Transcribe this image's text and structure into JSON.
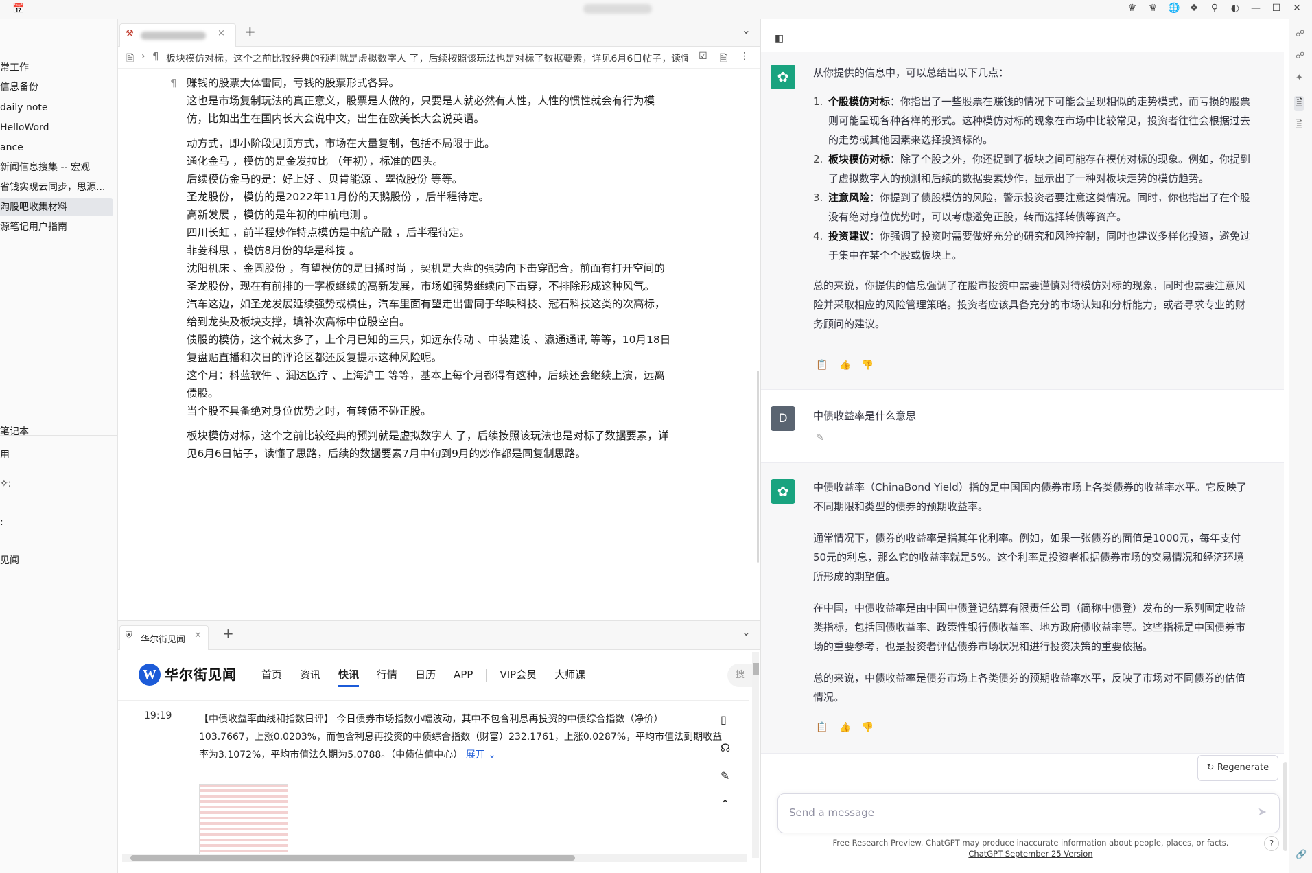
{
  "titlebar": {
    "icons": [
      "crown-icon",
      "crown-icon",
      "globe-icon",
      "puzzle-icon",
      "search-icon",
      "contrast-icon",
      "minimize-icon",
      "maximize-icon",
      "close-icon"
    ]
  },
  "sidebar": {
    "items": [
      {
        "label": "常工作"
      },
      {
        "label": "信息备份"
      },
      {
        "label": "daily note"
      },
      {
        "label": "HelloWord"
      },
      {
        "label": "ance"
      },
      {
        "label": "新闻信息搜集 -- 宏观"
      },
      {
        "label": "省钱实现云同步，思源..."
      },
      {
        "label": "淘股吧收集材料"
      },
      {
        "label": "源笔记用户指南"
      }
    ],
    "lower_items": [
      {
        "label": "笔记本"
      },
      {
        "label": "用"
      },
      {
        "label": "✧:"
      },
      {
        "label": ":"
      },
      {
        "label": "见闻"
      }
    ]
  },
  "editor": {
    "breadcrumb": "板块模仿对标，这个之前比较经典的预判就是虚拟数字人 了，后续按照该玩法也是对标了数据要素，详见6月6日帖子，读懂",
    "lines_1": [
      "赚钱的股票大体雷同，亏钱的股票形式各异。",
      "这也是市场复制玩法的真正意义，股票是人做的，只要是人就必然有人性，人性的惯性就会有行为模",
      "仿，比如出生在国内长大会说中文，出生在欧美长大会说英语。"
    ],
    "lines_2": [
      "动方式，即小阶段见顶方式，市场在大量复制，包括不局限于此。",
      "通化金马 ，模仿的是金发拉比 （年初），标准的四头。",
      "后续模仿金马的是：好上好 、贝肯能源 、翠微股份 等等。",
      "圣龙股份， 模仿的是2022年11月份的天鹅股份 ，后半程待定。",
      "高新发展 ，模仿的是年初的中航电测 。",
      "四川长虹 ，前半程炒作特点模仿是中航产融 ，后半程待定。",
      "菲菱科思 ，模仿8月份的华是科技 。",
      "沈阳机床 、金圆股份 ，有望模仿的是日播时尚 ，契机是大盘的强势向下击穿配合，前面有打开空间的",
      "圣龙股份，现在有前排的一字板继续的高新发展，市场如强势继续向下击穿，不排除形成这种风气。",
      "汽车这边，如圣龙发展延续强势或横住，汽车里面有望走出雷同于华映科技、冠石科技这类的次高标，",
      "给到龙头及板块支撑，填补次高标中位股空白。",
      "债股的模仿，这个就太多了，上个月已知的三只，如远东传动 、中装建设 、瀛通通讯 等等，10月18日",
      "复盘贴直播和次日的评论区都还反复提示这种风险呢。",
      "这个月：科蓝软件 、润达医疗 、上海沪工 等等，基本上每个月都得有这种，后续还会继续上演，远离",
      "债股。",
      "当个股不具备绝对身位优势之时，有转债不碰正股。"
    ],
    "lines_3": [
      "板块模仿对标，这个之前比较经典的预判就是虚拟数字人 了，后续按照该玩法也是对标了数据要素，详",
      "见6月6日帖子，读懂了思路，后续的数据要素7月中旬到9月的炒作都是同复制思路。"
    ]
  },
  "web": {
    "tab_label": "华尔街见闻",
    "logo_letter": "W",
    "site_name": "华尔街见闻",
    "nav": [
      "首页",
      "资讯",
      "快讯",
      "行情",
      "日历",
      "APP",
      "VIP会员",
      "大师课"
    ],
    "nav_active": "快讯",
    "search_placeholder": "搜",
    "news_time": "19:19",
    "news_lines": [
      "【中债收益率曲线和指数日评】 今日债券市场指数小幅波动，其中不包含利息再投资的中债综合指数（净价）",
      "103.7667，上涨0.0203%，而包含利息再投资的中债综合指数（财富）232.1761，上涨0.0287%，平均市值法到期收益",
      "率为3.1072%，平均市值法久期为5.0788。（中债估值中心）"
    ],
    "expand": "展开"
  },
  "chat": {
    "msg1_intro": "从你提供的信息中，可以总结出以下几点：",
    "msg1_items": [
      {
        "num": "1.",
        "title": "个股模仿对标",
        "lines": [
          "：你指出了一些股票在赚钱的情况下可能会呈现相似的走势模式，而亏损的股票",
          "则可能呈现各种各样的形式。这种模仿对标的现象在市场中比较常见，投资者往往会根据过去",
          "的走势或其他因素来选择投资标的。"
        ]
      },
      {
        "num": "2.",
        "title": "板块模仿对标",
        "lines": [
          "：除了个股之外，你还提到了板块之间可能存在模仿对标的现象。例如，你提到",
          "了虚拟数字人的预测和后续的数据要素炒作，显示出了一种对板块走势的模仿趋势。"
        ]
      },
      {
        "num": "3.",
        "title": "注意风险",
        "lines": [
          "：你提到了债股模仿的风险，警示投资者要注意这类情况。同时，你也指出了在个股",
          "没有绝对身位优势时，可以考虑避免正股，转而选择转债等资产。"
        ]
      },
      {
        "num": "4.",
        "title": "投资建议",
        "lines": [
          "：你强调了投资时需要做好充分的研究和风险控制，同时也建议多样化投资，避免过",
          "于集中在某个个股或板块上。"
        ]
      }
    ],
    "msg1_summary": [
      "总的来说，你提供的信息强调了在股市投资中需要谨慎对待模仿对标的现象，同时也需要注意风",
      "险并采取相应的风险管理策略。投资者应该具备充分的市场认知和分析能力，或者寻求专业的财",
      "务顾问的建议。"
    ],
    "user_avatar": "D",
    "user_msg": "中债收益率是什么意思",
    "msg2_paras": [
      [
        "中债收益率（ChinaBond Yield）指的是中国国内债券市场上各类债券的收益率水平。它反映了",
        "不同期限和类型的债券的预期收益率。"
      ],
      [
        "通常情况下，债券的收益率是指其年化利率。例如，如果一张债券的面值是1000元，每年支付",
        "50元的利息，那么它的收益率就是5%。这个利率是投资者根据债券市场的交易情况和经济环境",
        "所形成的期望值。"
      ],
      [
        "在中国，中债收益率是由中国中债登记结算有限责任公司（简称中债登）发布的一系列固定收益",
        "类指标，包括国债收益率、政策性银行债收益率、地方政府债收益率等。这些指标是中国债券市",
        "场的重要参考，也是投资者评估债券市场状况和进行投资决策的重要依据。"
      ],
      [
        "总的来说，中债收益率是债券市场上各类债券的预期收益率水平，反映了市场对不同债券的估值",
        "情况。"
      ]
    ],
    "regenerate": "Regenerate",
    "input_placeholder": "Send a message",
    "disclaimer_text": "Free Research Preview. ChatGPT may produce inaccurate information about people, places, or facts. ",
    "disclaimer_link": "ChatGPT September 25 Version",
    "help": "?"
  }
}
